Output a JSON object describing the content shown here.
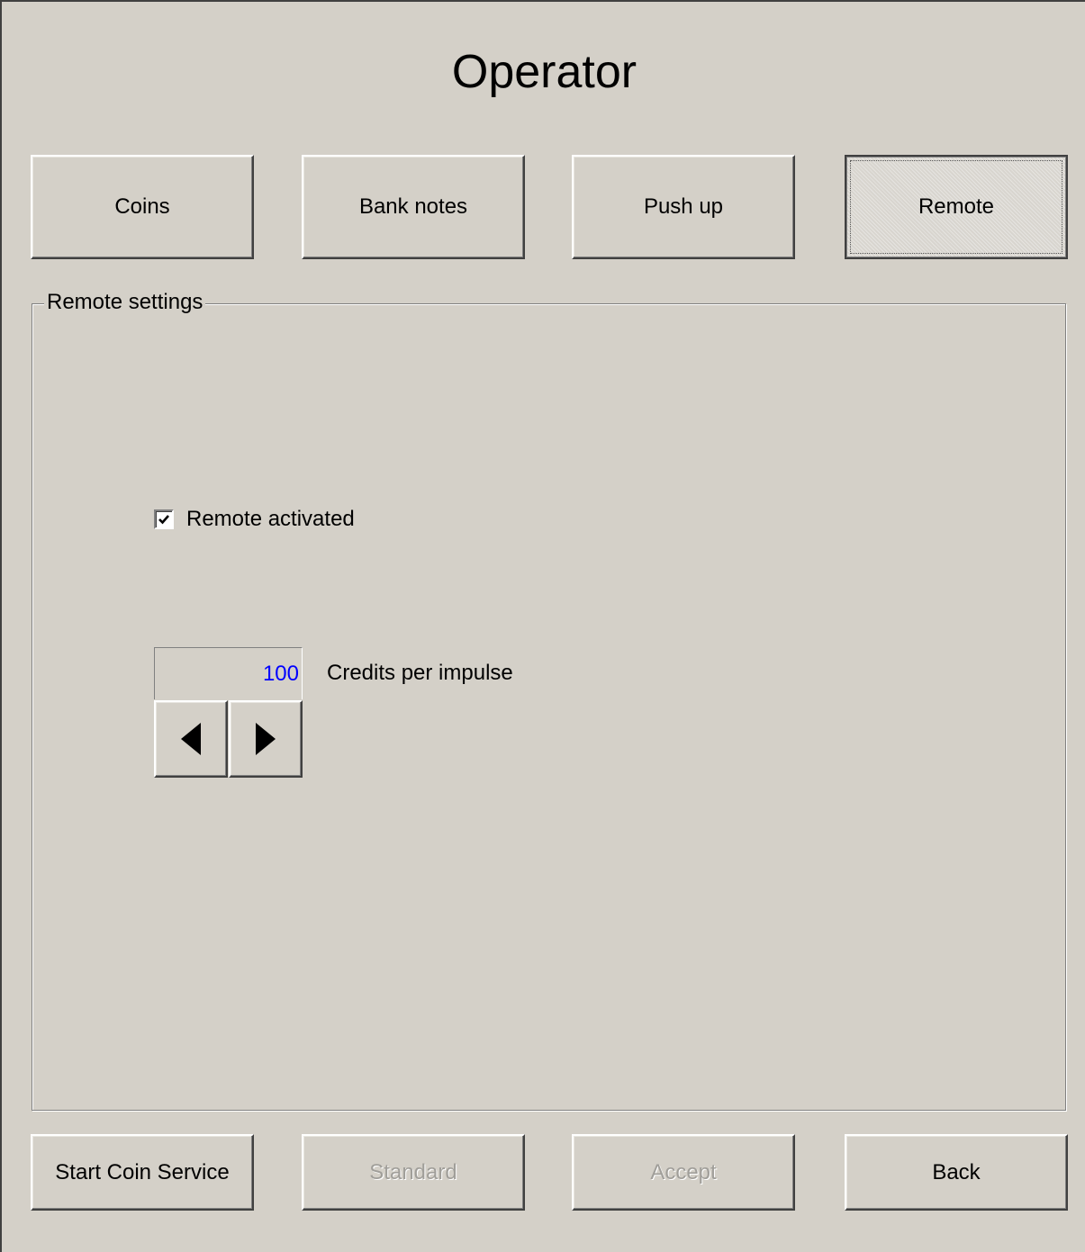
{
  "window": {
    "title": "Operator"
  },
  "tabs": [
    {
      "label": "Coins",
      "selected": false
    },
    {
      "label": "Bank notes",
      "selected": false
    },
    {
      "label": "Push up",
      "selected": false
    },
    {
      "label": "Remote",
      "selected": true
    }
  ],
  "group": {
    "legend": "Remote settings",
    "remote_activated": {
      "label": "Remote activated",
      "checked": true
    },
    "credits": {
      "value": "100",
      "label": "Credits per impulse",
      "value_color": "#0000ff"
    },
    "decrease_icon": "triangle-left-icon",
    "increase_icon": "triangle-right-icon"
  },
  "footer": {
    "start_coin_service": "Start Coin Service",
    "standard": "Standard",
    "accept": "Accept",
    "back": "Back"
  }
}
